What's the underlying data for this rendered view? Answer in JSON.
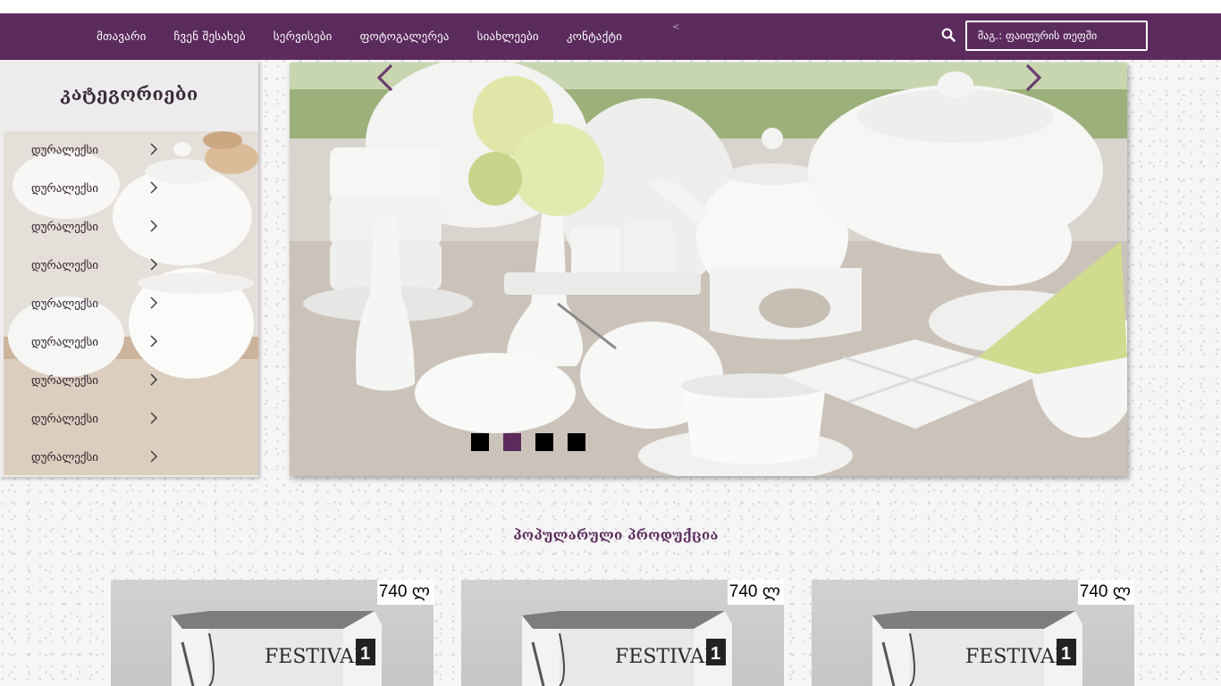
{
  "nav": {
    "items": [
      {
        "label": "მთავარი"
      },
      {
        "label": "ჩვენ შესახებ"
      },
      {
        "label": "სერვისები"
      },
      {
        "label": "ფოტოგალერეა"
      },
      {
        "label": "სიახლეები"
      },
      {
        "label": "კონტაქტი"
      }
    ],
    "caret": "<"
  },
  "search": {
    "placeholder": "მაგ.: ფაიფურის თეფში",
    "icon": "search-icon"
  },
  "sidebar": {
    "title": "კატეგორიები",
    "items": [
      {
        "label": "დურალექსი"
      },
      {
        "label": "დურალექსი"
      },
      {
        "label": "დურალექსი"
      },
      {
        "label": "დურალექსი"
      },
      {
        "label": "დურალექსი"
      },
      {
        "label": "დურალექსი"
      },
      {
        "label": "დურალექსი"
      },
      {
        "label": "დურალექსი"
      },
      {
        "label": "დურალექსი"
      }
    ]
  },
  "slider": {
    "slide_count": 4,
    "active_index": 1
  },
  "popular": {
    "title": "პოპულარული პროდუქცია",
    "products": [
      {
        "price": "740 ლ",
        "brand": "FESTIVAL",
        "badge": "1"
      },
      {
        "price": "740 ლ",
        "brand": "FESTIVAL",
        "badge": "1"
      },
      {
        "price": "740 ლ",
        "brand": "FESTIVAL",
        "badge": "1"
      }
    ]
  },
  "colors": {
    "brand": "#5b2b5d",
    "dot_inactive": "#000000",
    "dot_active": "#5b2b5d"
  }
}
